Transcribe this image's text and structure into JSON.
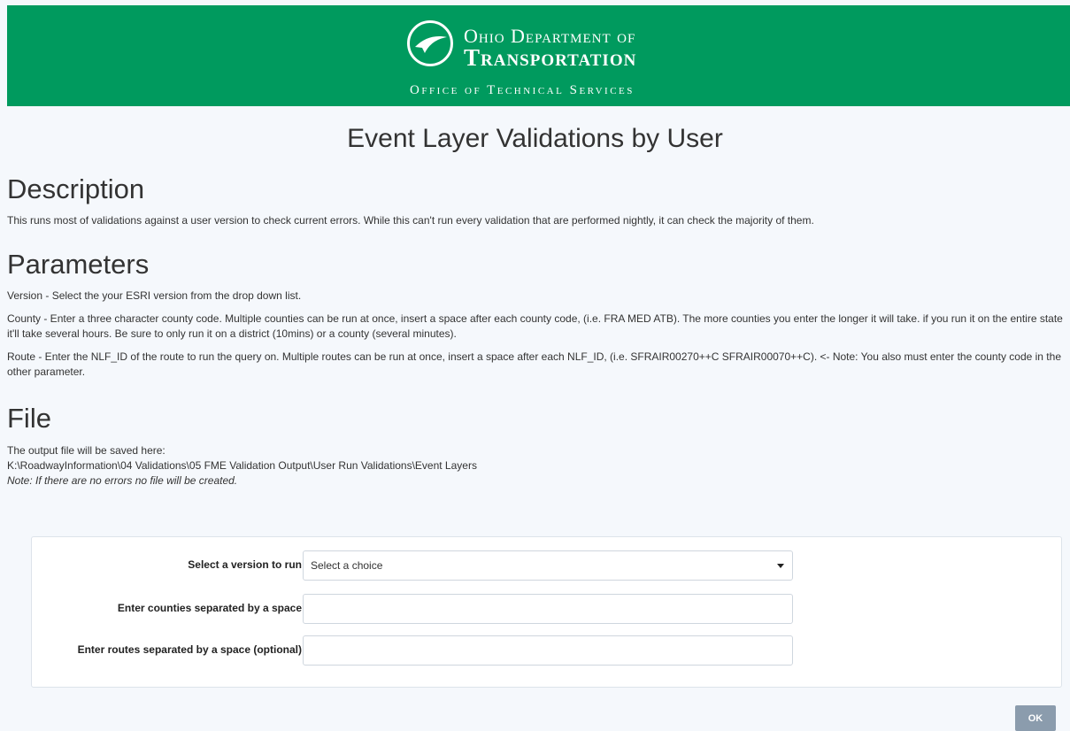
{
  "header": {
    "line1": "Ohio Department of",
    "line2": "Transportation",
    "office": "Office of Technical Services"
  },
  "page": {
    "title": "Event Layer Validations by User"
  },
  "description": {
    "heading": "Description",
    "text": "This runs most of validations against a user version to check current errors. While this can't run every validation that are performed nightly, it can check the majority of them."
  },
  "parameters": {
    "heading": "Parameters",
    "version_text": "Version - Select the your ESRI version from the drop down list.",
    "county_text": "County - Enter a three character county code. Multiple counties can be run at once, insert a space after each county code, (i.e. FRA MED ATB). The more counties you enter the longer it will take. if you run it on the entire state it'll take several hours. Be sure to only run it on a district (10mins) or a county (several minutes).",
    "route_text": "Route - Enter the NLF_ID of the route to run the query on. Multiple routes can be run at once, insert a space after each NLF_ID, (i.e. SFRAIR00270++C SFRAIR00070++C). <- Note: You also must enter the county code in the other parameter."
  },
  "file": {
    "heading": "File",
    "intro": "The output file will be saved here:",
    "path": "K:\\RoadwayInformation\\04 Validations\\05 FME Validation Output\\User Run Validations\\Event Layers",
    "note": "Note: If there are no errors no file will be created."
  },
  "form": {
    "version_label": "Select a version to run",
    "version_selected": "Select a choice",
    "counties_label": "Enter counties separated by a space",
    "counties_value": "",
    "routes_label": "Enter routes separated by a space (optional)",
    "routes_value": "",
    "ok_label": "OK"
  },
  "colors": {
    "header_green": "#009a5e",
    "button_gray": "#8b9cad",
    "page_bg": "#f5f8fc"
  },
  "icons": {
    "logo": "odot-logo-icon",
    "caret": "caret-down-icon"
  }
}
